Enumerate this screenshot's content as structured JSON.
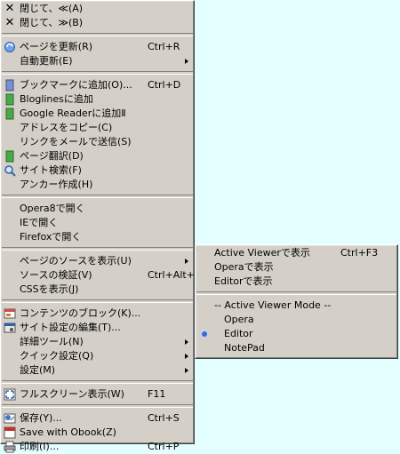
{
  "main_menu": {
    "close_left": "閉じて、≪(A)",
    "close_right": "閉じて、≫(B)",
    "reload": {
      "label": "ページを更新(R)",
      "shortcut": "Ctrl+R"
    },
    "auto_reload": "自動更新(E)",
    "bookmark": {
      "label": "ブックマークに追加(O)...",
      "shortcut": "Ctrl+D"
    },
    "bloglines": "Bloglinesに追加",
    "google_reader": "Google Readerに追加Ⅱ",
    "copy_address": "アドレスをコピー(C)",
    "mail_link": "リンクをメールで送信(S)",
    "translate": "ページ翻訳(D)",
    "site_search": "サイト検索(F)",
    "create_anchor": "アンカー作成(H)",
    "open_opera8": "Opera8で開く",
    "open_ie": "IEで開く",
    "open_firefox": "Firefoxで開く",
    "view_source": "ページのソースを表示(U)",
    "validate_source": {
      "label": "ソースの検証(V)",
      "shortcut": "Ctrl+Alt+V"
    },
    "show_css": "CSSを表示(J)",
    "block_content": "コンテンツのブロック(K)...",
    "edit_site_settings": "サイト設定の編集(T)...",
    "detail_tools": "詳細ツール(N)",
    "quick_settings": "クイック設定(Q)",
    "settings": "設定(M)",
    "fullscreen": {
      "label": "フルスクリーン表示(W)",
      "shortcut": "F11"
    },
    "save": {
      "label": "保存(Y)...",
      "shortcut": "Ctrl+S"
    },
    "save_obook": "Save with Obook(Z)",
    "print": {
      "label": "印刷(I)...",
      "shortcut": "Ctrl+P"
    }
  },
  "sub_menu": {
    "active_viewer": {
      "label": "Active Viewerで表示",
      "shortcut": "Ctrl+F3"
    },
    "opera_view": "Operaで表示",
    "editor_view": "Editorで表示",
    "mode_header": "-- Active Viewer Mode --",
    "modes": [
      "Opera",
      "Editor",
      "NotePad"
    ],
    "selected_mode": "Editor"
  },
  "colors": {
    "menu_bg": "#d4d0c8",
    "desktop_bg": "#e3ffff",
    "radio_accent": "#3a6ad0"
  }
}
